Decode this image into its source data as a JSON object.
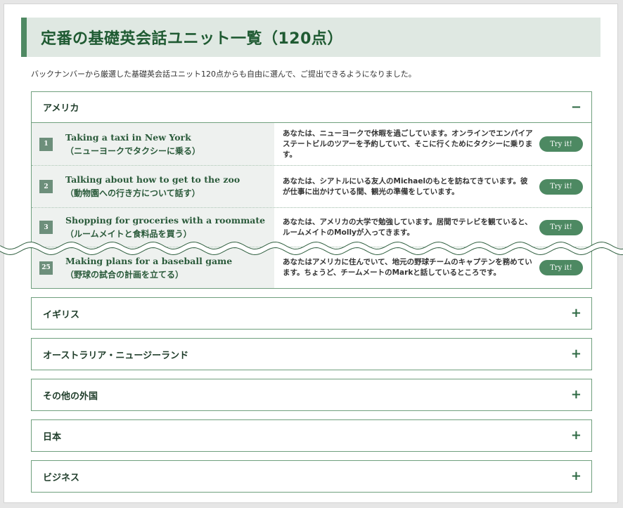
{
  "page": {
    "title": "定番の基礎英会話ユニット一覧（120点）",
    "intro": "バックナンバーから厳選した基礎英会話ユニット120点からも自由に選んで、ご提出できるようになりました。"
  },
  "sections": [
    {
      "label": "アメリカ",
      "toggle": "−",
      "expanded": true,
      "units": [
        {
          "number": "1",
          "title_en": "Taking a taxi in New York",
          "title_ja": "（ニューヨークでタクシーに乗る）",
          "description": "あなたは、ニューヨークで休暇を過ごしています。オンラインでエンパイアステートビルのツアーを予約していて、そこに行くためにタクシーに乗ります。",
          "button": "Try it!"
        },
        {
          "number": "2",
          "title_en": "Talking about how to get to the zoo",
          "title_ja": "（動物園への行き方について話す）",
          "description": "あなたは、シアトルにいる友人のMichaelのもとを訪ねてきています。彼が仕事に出かけている間、観光の準備をしています。",
          "button": "Try it!"
        },
        {
          "number": "3",
          "title_en": "Shopping for groceries with a roommate",
          "title_ja": "（ルームメイトと食料品を買う）",
          "description": "あなたは、アメリカの大学で勉強しています。居間でテレビを観ていると、ルームメイトのMollyが入ってきます。",
          "button": "Try it!"
        },
        {
          "number": "25",
          "title_en": "Making plans for a baseball game",
          "title_ja": "（野球の試合の計画を立てる）",
          "description": "あなたはアメリカに住んでいて、地元の野球チームのキャプテンを務めています。ちょうど、チームメートのMarkと話しているところです。",
          "button": "Try it!"
        }
      ]
    },
    {
      "label": "イギリス",
      "toggle": "+",
      "expanded": false
    },
    {
      "label": "オーストラリア・ニュージーランド",
      "toggle": "+",
      "expanded": false
    },
    {
      "label": "その他の外国",
      "toggle": "+",
      "expanded": false
    },
    {
      "label": "日本",
      "toggle": "+",
      "expanded": false
    },
    {
      "label": "ビジネス",
      "toggle": "+",
      "expanded": false
    }
  ],
  "colors": {
    "accent": "#4d8962",
    "heading_bg": "#dfe8e2",
    "border": "#6f9f7d",
    "wave": "#2f5f3f"
  }
}
